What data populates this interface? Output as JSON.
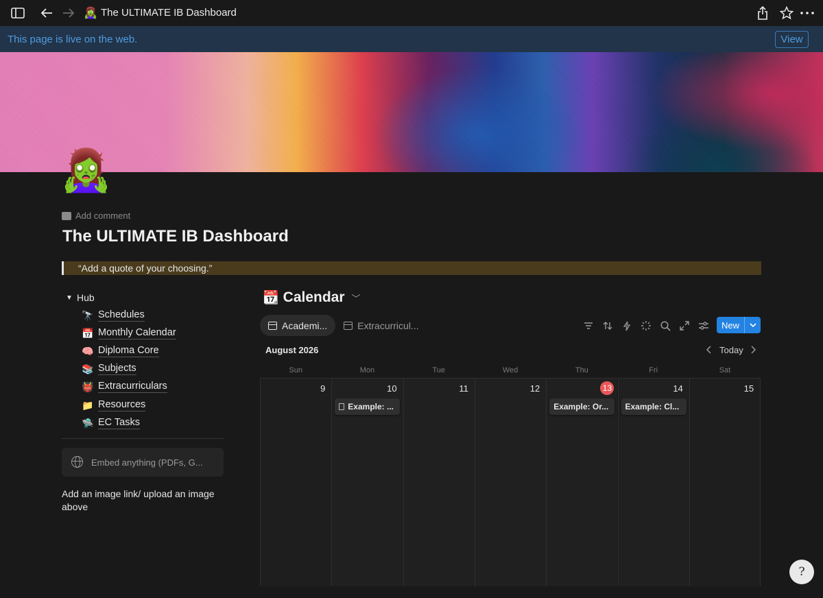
{
  "browser": {
    "title": "The ULTIMATE IB Dashboard",
    "page_emoji": "🧟‍♀️"
  },
  "banner": {
    "text": "This page is live on the web.",
    "view_label": "View"
  },
  "page": {
    "icon": "🧟‍♀️",
    "add_comment": "Add comment",
    "title": "The ULTIMATE  IB Dashboard",
    "quote": "“Add a quote of your choosing.”"
  },
  "hub": {
    "heading": "Hub",
    "items": [
      {
        "emoji": "🔭",
        "label": "Schedules"
      },
      {
        "emoji": "📅",
        "label": "Monthly Calendar"
      },
      {
        "emoji": "🧠",
        "label": "Diploma Core"
      },
      {
        "emoji": "📚",
        "label": "Subjects"
      },
      {
        "emoji": "👹",
        "label": "Extracurriculars"
      },
      {
        "emoji": "📁",
        "label": "Resources"
      },
      {
        "emoji": "🛸",
        "label": "EC Tasks"
      }
    ],
    "embed_placeholder": "Embed anything (PDFs, G...",
    "note": "Add an image link/ upload an image above"
  },
  "calendar": {
    "icon": "📆",
    "title": "Calendar",
    "tabs": [
      "Academi...",
      "Extracurricul..."
    ],
    "new_label": "New",
    "month": "August 2026",
    "today_label": "Today",
    "weekdays": [
      "Sun",
      "Mon",
      "Tue",
      "Wed",
      "Thu",
      "Fri",
      "Sat"
    ],
    "days": [
      "9",
      "10",
      "11",
      "12",
      "13",
      "14",
      "15"
    ],
    "current_day": "13",
    "events": {
      "mon": "Example: ...",
      "thu": "Example: Or...",
      "fri": "Example: Cl..."
    }
  },
  "colors": {
    "accent_blue": "#2383e2",
    "banner_bg": "#223449",
    "quote_bg": "#493b1c",
    "today_badge": "#eb5757"
  },
  "icons": [
    "sidebar-toggle-icon",
    "back-arrow-icon",
    "forward-arrow-icon",
    "share-icon",
    "star-icon",
    "more-icon",
    "filter-icon",
    "sort-icon",
    "automation-icon",
    "ai-icon",
    "search-icon",
    "expand-icon",
    "settings-icon",
    "help-icon"
  ]
}
